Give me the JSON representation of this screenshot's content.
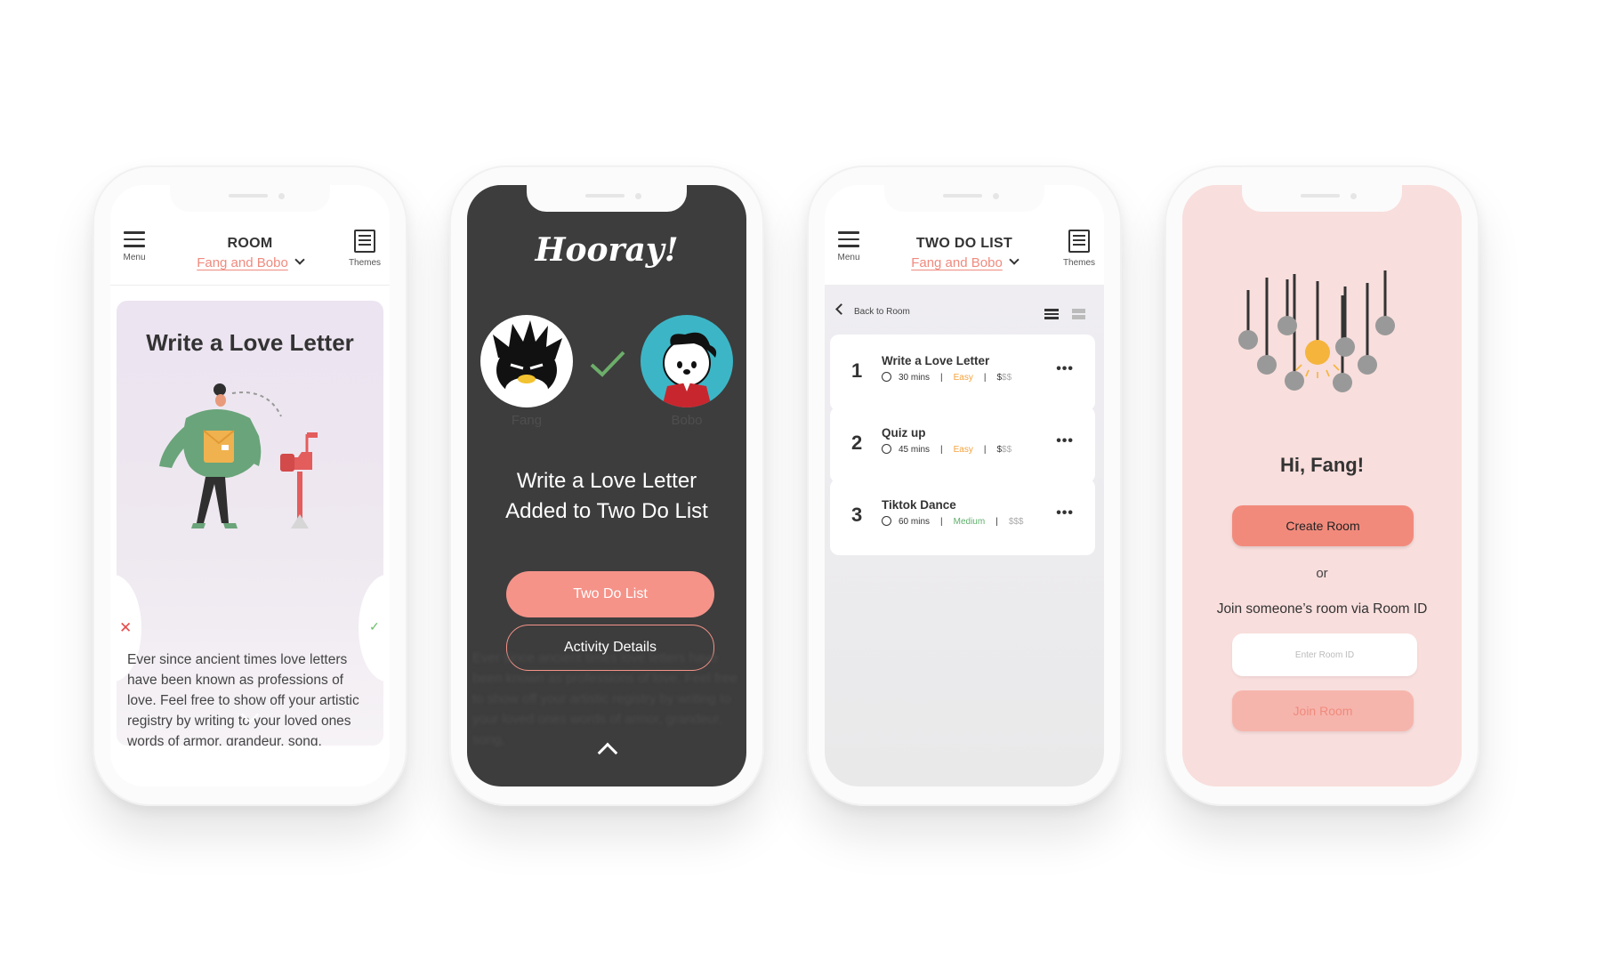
{
  "room_screen": {
    "menu_label": "Menu",
    "title": "ROOM",
    "room_name": "Fang and Bobo",
    "themes_label": "Themes",
    "card_title": "Write a Love Letter",
    "card_body": "Ever since ancient times love letters have been known as professions of love. Feel free to show off your artistic registry by writing to your loved ones words of armor, grandeur, song,"
  },
  "hooray_screen": {
    "heading": "Hooray!",
    "user_left": "Fang",
    "user_right": "Bobo",
    "message_line1": "Write a Love Letter",
    "message_line2": "Added to Two Do List",
    "primary_button": "Two Do List",
    "secondary_button": "Activity Details"
  },
  "list_screen": {
    "menu_label": "Menu",
    "title": "TWO DO LIST",
    "room_name": "Fang and Bobo",
    "themes_label": "Themes",
    "back_label": "Back to Room",
    "tasks": [
      {
        "num": "1",
        "title": "Write a Love Letter",
        "duration": "30 mins",
        "difficulty": "Easy",
        "cost": "$",
        "cost_dim": "$$"
      },
      {
        "num": "2",
        "title": "Quiz up",
        "duration": "45 mins",
        "difficulty": "Easy",
        "cost": "$",
        "cost_dim": "$$"
      },
      {
        "num": "3",
        "title": "Tiktok Dance",
        "duration": "60 mins",
        "difficulty": "Medium",
        "cost": "",
        "cost_dim": "$$$"
      }
    ],
    "more_glyph": "•••",
    "separator": "|"
  },
  "welcome_screen": {
    "greeting": "Hi, Fang!",
    "create_button": "Create Room",
    "or_text": "or",
    "join_text": "Join someone’s room via Room ID",
    "room_id_placeholder": "Enter Room ID",
    "join_button": "Join Room"
  },
  "colors": {
    "accent": "#f59389",
    "dark_bg": "#3d3d3d",
    "pink_bg": "#f8dedc",
    "easy": "#f5a23c",
    "medium": "#5fae6b"
  }
}
